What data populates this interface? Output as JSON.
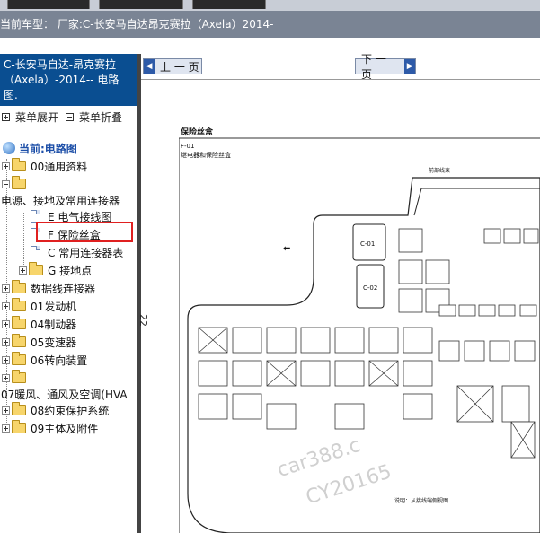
{
  "info_bar": {
    "text": "当前车型：  厂家:C-长安马自达昂克赛拉（Axela）2014-"
  },
  "left": {
    "title": "C-长安马自达-昂克赛拉（Axela）-2014-- 电路图.",
    "expand_all": "菜单展开",
    "collapse_all": "菜单折叠",
    "current_label": "当前:电路图",
    "tree": [
      "00通用资料",
      "",
      "电源、接地及常用连接器",
      "E 电气接线图",
      "F 保险丝盒",
      "C 常用连接器表",
      "G 接地点",
      "数据线连接器",
      "01发动机",
      "04制动器",
      "05变速器",
      "06转向装置",
      "",
      "07暖风、通风及空调(HVA",
      "08约束保护系统",
      "09主体及附件"
    ]
  },
  "nav": {
    "prev": "上 一 页",
    "next": "下 一 页"
  },
  "page": {
    "number": "22",
    "title": "保险丝盒",
    "code": "F-01",
    "subtitle": "继电器和保险丝盒",
    "label_front": "前部线束",
    "c01": "C-01",
    "c02": "C-02",
    "note": "说明：从接线端侧视图",
    "watermark_1": "car388.c",
    "watermark_2": "CY20165"
  },
  "colors": {
    "title_bg": "#0a4e91",
    "info_bg": "#7a8494",
    "highlight": "#e02020"
  }
}
